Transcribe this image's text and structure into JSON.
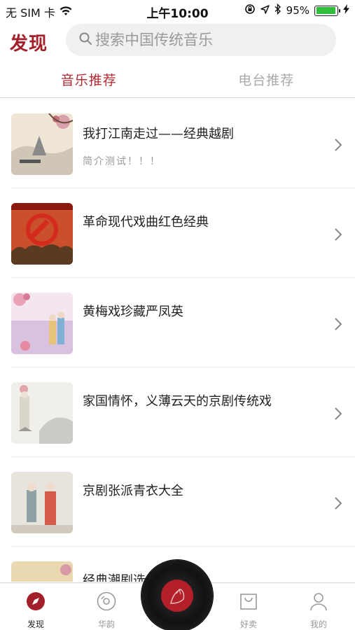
{
  "status_bar": {
    "carrier": "无 SIM 卡",
    "time": "上午10:00",
    "battery_percent": "95%",
    "battery_level": 0.95,
    "wifi_icon": "wifi-icon",
    "battery_color": "#2fbf3a"
  },
  "header": {
    "title": "发现",
    "search_placeholder": "搜索中国传统音乐",
    "accent_color": "#a3202a"
  },
  "tabs": [
    {
      "label": "音乐推荐",
      "active": true
    },
    {
      "label": "电台推荐",
      "active": false
    }
  ],
  "list": [
    {
      "title": "我打江南走过——经典越剧",
      "subtitle": "简介测试！！！"
    },
    {
      "title": "革命现代戏曲红色经典",
      "subtitle": ""
    },
    {
      "title": "黄梅戏珍藏严凤英",
      "subtitle": ""
    },
    {
      "title": "家国情怀，义薄云天的京剧传统戏",
      "subtitle": ""
    },
    {
      "title": "京剧张派青衣大全",
      "subtitle": ""
    },
    {
      "title": "经典潮剧选",
      "subtitle": ""
    }
  ],
  "bottom_nav": [
    {
      "label": "发现",
      "icon": "compass-icon",
      "active": true
    },
    {
      "label": "华韵",
      "icon": "disc-icon",
      "active": false
    },
    {
      "label": "好卖",
      "icon": "shopping-bag-icon",
      "active": false
    },
    {
      "label": "我的",
      "icon": "user-icon",
      "active": false
    }
  ]
}
